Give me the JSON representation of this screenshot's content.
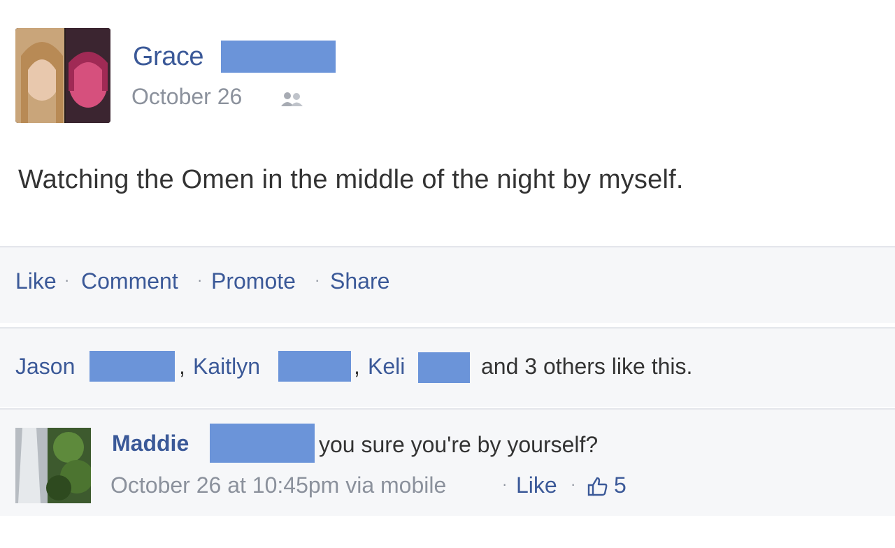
{
  "post": {
    "author": "Grace",
    "date": "October 26",
    "text": "Watching the Omen in the middle of the night by myself."
  },
  "actions": {
    "like": "Like",
    "comment": "Comment",
    "promote": "Promote",
    "share": "Share"
  },
  "likes": {
    "names": [
      "Jason",
      "Kaitlyn",
      "Keli"
    ],
    "suffix": "and 3 others like this."
  },
  "comment": {
    "author": "Maddie",
    "text": "you sure you're by yourself?",
    "meta": "October 26 at 10:45pm via mobile",
    "like_label": "Like",
    "like_count": "5"
  },
  "colors": {
    "link": "#3b5998",
    "redaction": "#6b94d9",
    "muted": "#8b919c"
  }
}
